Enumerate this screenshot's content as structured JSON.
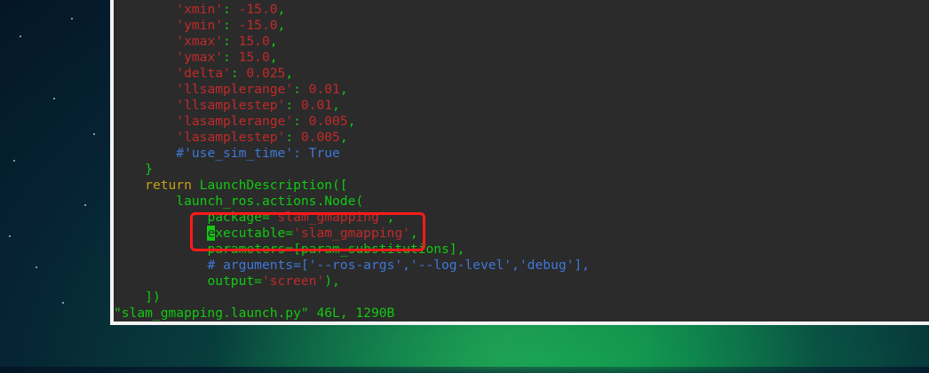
{
  "editor": {
    "lines": [
      {
        "indent": "        ",
        "key": "'xmin'",
        "sep": ": ",
        "value": "-15.0",
        "tail": ","
      },
      {
        "indent": "        ",
        "key": "'ymin'",
        "sep": ": ",
        "value": "-15.0",
        "tail": ","
      },
      {
        "indent": "        ",
        "key": "'xmax'",
        "sep": ": ",
        "value": "15.0",
        "tail": ","
      },
      {
        "indent": "        ",
        "key": "'ymax'",
        "sep": ": ",
        "value": "15.0",
        "tail": ","
      },
      {
        "indent": "        ",
        "key": "'delta'",
        "sep": ": ",
        "value": "0.025",
        "tail": ","
      },
      {
        "indent": "        ",
        "key": "'llsamplerange'",
        "sep": ": ",
        "value": "0.01",
        "tail": ","
      },
      {
        "indent": "        ",
        "key": "'llsamplestep'",
        "sep": ": ",
        "value": "0.01",
        "tail": ","
      },
      {
        "indent": "        ",
        "key": "'lasamplerange'",
        "sep": ": ",
        "value": "0.005",
        "tail": ","
      },
      {
        "indent": "        ",
        "key": "'lasamplestep'",
        "sep": ": ",
        "value": "0.005",
        "tail": ","
      }
    ],
    "comment_line": {
      "indent": "        ",
      "text": "#'use_sim_time': True"
    },
    "close_brace": {
      "indent": "    ",
      "text": "}"
    },
    "return_line": {
      "indent": "    ",
      "keyword": "return",
      "rest": " LaunchDescription(["
    },
    "node_line": {
      "indent": "        ",
      "text": "launch_ros.actions.Node("
    },
    "package_line": {
      "indent": "            ",
      "key": "package=",
      "value": "'slam_gmapping'",
      "tail": ","
    },
    "executable_line": {
      "indent": "            ",
      "cursor_char": "e",
      "key": "xecutable=",
      "value": "'slam_gmapping'",
      "tail": ","
    },
    "parameters_line": {
      "indent": "            ",
      "text": "parameters=[param_substitutions],"
    },
    "arguments_line": {
      "indent": "            ",
      "text": "# arguments=['--ros-args','--log-level','debug'],"
    },
    "output_line": {
      "indent": "            ",
      "key": "output=",
      "value": "'screen'",
      "tail": "),"
    },
    "close_bracket": {
      "indent": "    ",
      "text": "])"
    },
    "status": "\"slam_gmapping.launch.py\" 46L, 1290B"
  },
  "colors": {
    "terminal_bg": "#2b2b2b",
    "string": "#c22a2a",
    "plain": "#11c911",
    "comment": "#3f78d8",
    "keyword": "#c9a014",
    "annotation_box": "#ff1a1a"
  }
}
